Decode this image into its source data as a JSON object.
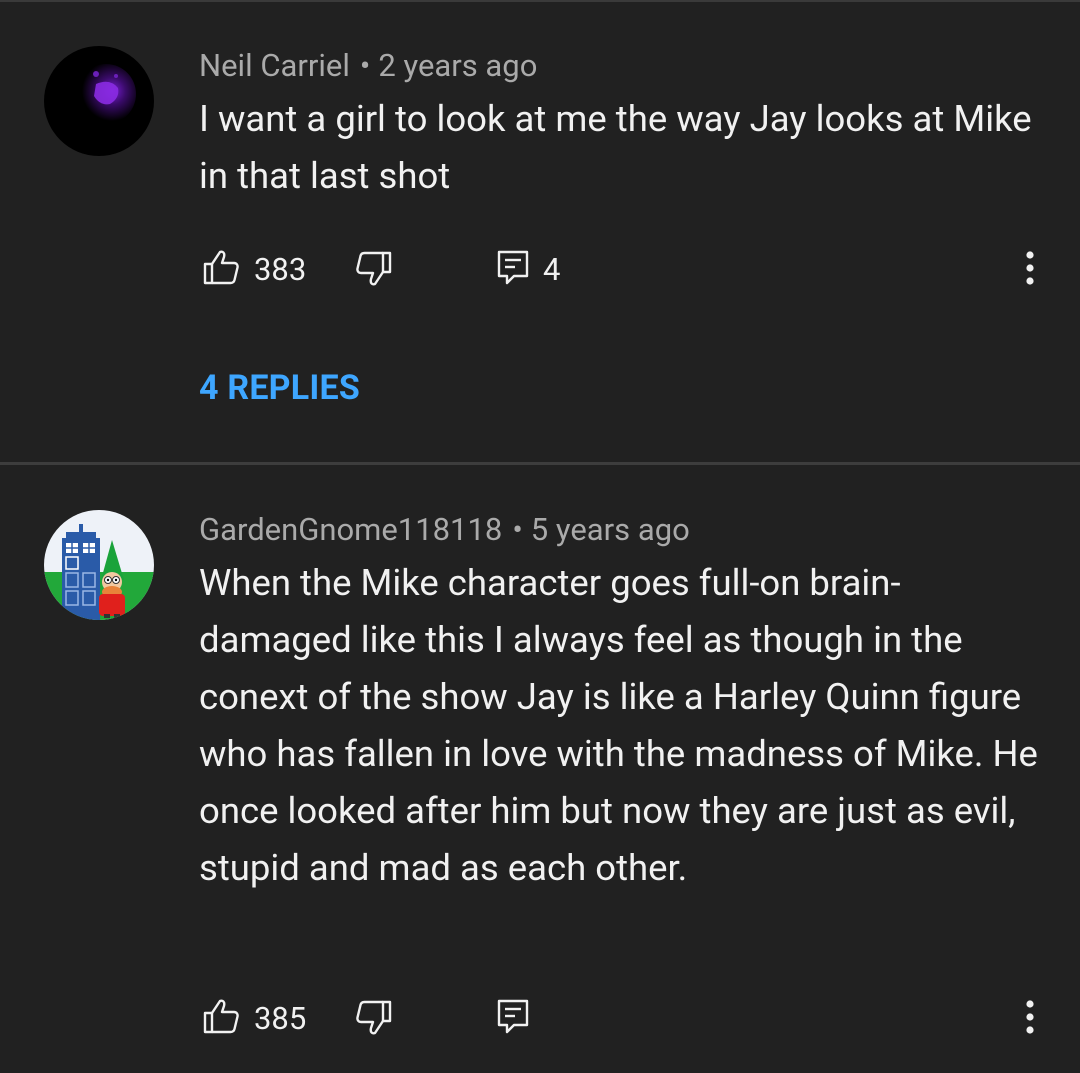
{
  "comments": [
    {
      "author": "Neil Carriel",
      "separator": "•",
      "time": "2 years ago",
      "text": "I want a girl to look at me the way Jay looks at Mike in that last shot",
      "likes": "383",
      "reply_count": "4",
      "replies_link": "4 REPLIES",
      "avatar_icon": "dark-purple-avatar"
    },
    {
      "author": "GardenGnome118118",
      "separator": "•",
      "time": "5 years ago",
      "text": "When the Mike character goes full-on brain-damaged like this I always feel as though in the conext of the show Jay is like a Harley Quinn figure who has fallen in love with the madness of Mike. He once looked after him but now they are just as evil, stupid and mad as each other.",
      "likes": "385",
      "avatar_icon": "garden-gnome-tardis-avatar"
    }
  ],
  "colors": {
    "background": "#212121",
    "text_primary": "#f1f1f1",
    "text_secondary": "#aaaaaa",
    "link_blue": "#3ea6ff",
    "divider": "#3d3d3d"
  },
  "icons": [
    "thumb-up-icon",
    "thumb-down-icon",
    "reply-icon",
    "more-vert-icon"
  ]
}
